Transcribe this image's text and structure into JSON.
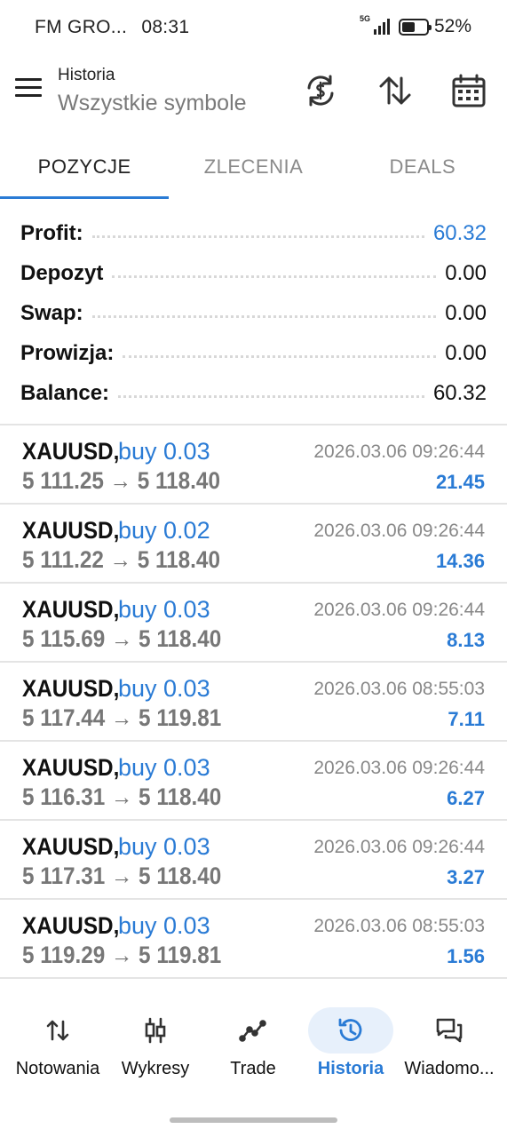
{
  "status_bar": {
    "carrier": "FM GRO...",
    "time": "08:31",
    "network": "5G",
    "battery": "52%",
    "battery_level": 0.52
  },
  "header": {
    "title": "Historia",
    "subtitle": "Wszystkie symbole",
    "actions": [
      "currency-exchange-icon",
      "sort-icon",
      "calendar-icon"
    ]
  },
  "tabs": [
    {
      "label": "POZYCJE",
      "active": true
    },
    {
      "label": "ZLECENIA",
      "active": false
    },
    {
      "label": "DEALS",
      "active": false
    }
  ],
  "summary": {
    "rows": [
      {
        "label": "Profit:",
        "value": "60.32"
      },
      {
        "label": "Depozyt",
        "value": "0.00"
      },
      {
        "label": "Swap:",
        "value": "0.00"
      },
      {
        "label": "Prowizja:",
        "value": "0.00"
      },
      {
        "label": "Balance:",
        "value": "60.32"
      }
    ]
  },
  "trades": [
    {
      "symbol": "XAUUSD,",
      "side": "buy 0.03",
      "prices": "5 111.25 → 5 118.40",
      "time": "2026.03.06 09:26:44",
      "profit": "21.45"
    },
    {
      "symbol": "XAUUSD,",
      "side": "buy 0.02",
      "prices": "5 111.22 → 5 118.40",
      "time": "2026.03.06 09:26:44",
      "profit": "14.36"
    },
    {
      "symbol": "XAUUSD,",
      "side": "buy 0.03",
      "prices": "5 115.69 → 5 118.40",
      "time": "2026.03.06 09:26:44",
      "profit": "8.13"
    },
    {
      "symbol": "XAUUSD,",
      "side": "buy 0.03",
      "prices": "5 117.44 → 5 119.81",
      "time": "2026.03.06 08:55:03",
      "profit": "7.11"
    },
    {
      "symbol": "XAUUSD,",
      "side": "buy 0.03",
      "prices": "5 116.31 → 5 118.40",
      "time": "2026.03.06 09:26:44",
      "profit": "6.27"
    },
    {
      "symbol": "XAUUSD,",
      "side": "buy 0.03",
      "prices": "5 117.31 → 5 118.40",
      "time": "2026.03.06 09:26:44",
      "profit": "3.27"
    },
    {
      "symbol": "XAUUSD,",
      "side": "buy 0.03",
      "prices": "5 119.29 → 5 119.81",
      "time": "2026.03.06 08:55:03",
      "profit": "1.56"
    }
  ],
  "bottom_nav": [
    {
      "label": "Notowania",
      "icon": "quotes-icon",
      "active": false
    },
    {
      "label": "Wykresy",
      "icon": "chart-icon",
      "active": false
    },
    {
      "label": "Trade",
      "icon": "trade-icon",
      "active": false
    },
    {
      "label": "Historia",
      "icon": "history-icon",
      "active": true
    },
    {
      "label": "Wiadomo...",
      "icon": "messages-icon",
      "active": false
    }
  ],
  "colors": {
    "accent": "#2a7bd5",
    "text": "#111111",
    "muted": "#777777",
    "divider": "#e4e4e4",
    "active_nav_bg": "#e7f0fb"
  }
}
